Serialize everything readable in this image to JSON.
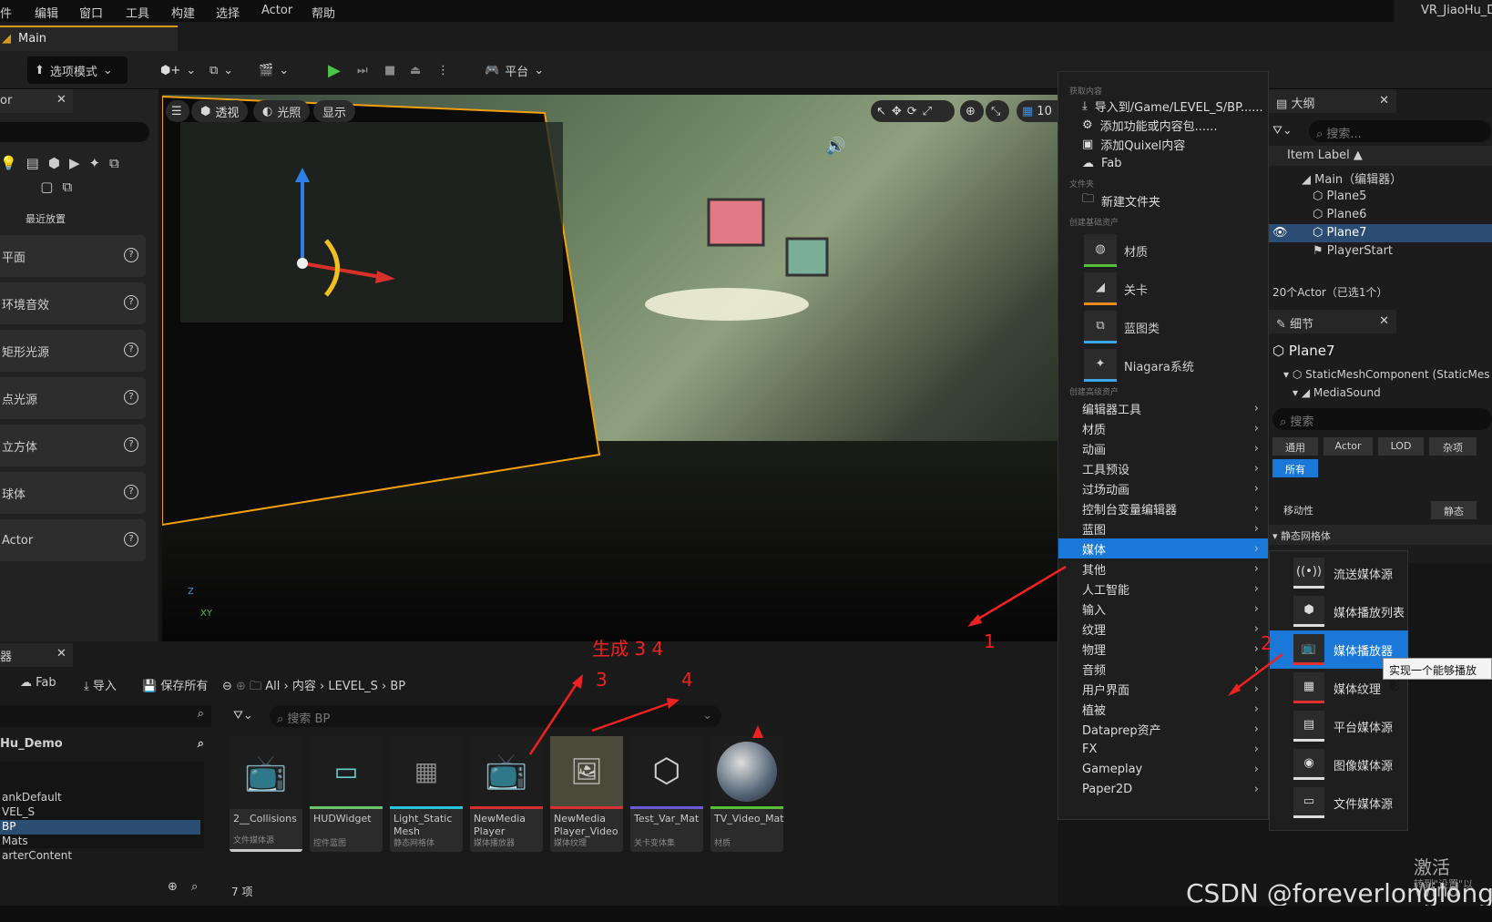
{
  "menubar": {
    "items": [
      "件",
      "编辑",
      "窗口",
      "工具",
      "构建",
      "选择",
      "Actor",
      "帮助"
    ],
    "project": "VR_JiaoHu_D"
  },
  "tabs": {
    "main": "Main"
  },
  "toolbar": {
    "mode": "选项模式",
    "platform": "平台"
  },
  "left_panel": {
    "title": "or",
    "recent": "最近放置",
    "items": [
      "平面",
      "环境音效",
      "矩形光源",
      "点光源",
      "立方体",
      "球体",
      "Actor"
    ]
  },
  "viewport": {
    "perspective": "透视",
    "lighting": "光照",
    "show": "显示",
    "grid": "10",
    "axis_z": "Z",
    "axis_xy": "XY"
  },
  "context_menu": {
    "section_get": "获取内容",
    "get_items": [
      "导入到/Game/LEVEL_S/BP......",
      "添加功能或内容包......",
      "添加Quixel内容",
      "Fab"
    ],
    "section_folder": "文件夹",
    "new_folder": "新建文件夹",
    "section_basic": "创建基础资产",
    "basic_assets": [
      "材质",
      "关卡",
      "蓝图类",
      "Niagara系统"
    ],
    "section_advanced": "创建高级资产",
    "advanced": [
      "编辑器工具",
      "材质",
      "动画",
      "工具预设",
      "过场动画",
      "控制台变量编辑器",
      "蓝图",
      "媒体",
      "其他",
      "人工智能",
      "输入",
      "纹理",
      "物理",
      "音频",
      "用户界面",
      "植被",
      "Dataprep资产",
      "FX",
      "Gameplay",
      "Paper2D"
    ]
  },
  "media_submenu": [
    "流送媒体源",
    "媒体播放列表",
    "媒体播放器",
    "媒体纹理",
    "平台媒体源",
    "图像媒体源",
    "文件媒体源"
  ],
  "tooltip": "实现一个能够播放影",
  "outliner": {
    "title": "大纲",
    "search": "搜索...",
    "column": "Item Label",
    "items": [
      "Main（编辑器）",
      "Plane5",
      "Plane6",
      "Plane7",
      "PlayerStart"
    ],
    "count": "20个Actor（已选1个）"
  },
  "details": {
    "title": "细节",
    "object": "Plane7",
    "component": "StaticMeshComponent (StaticMes",
    "sub": "MediaSound",
    "search": "搜索",
    "filters": [
      "通用",
      "Actor",
      "LOD",
      "杂项",
      "所有"
    ],
    "mobility_label": "移动性",
    "mobility_value": "静态",
    "section": "静态网格体"
  },
  "content_browser": {
    "title": "器",
    "fab": "Fab",
    "import": "导入",
    "save_all": "保存所有",
    "path": [
      "All",
      "内容",
      "LEVEL_S",
      "BP"
    ],
    "search": "搜索 BP",
    "project": "Hu_Demo",
    "folders": [
      "ankDefault",
      "VEL_S",
      "BP",
      "Mats",
      "arterContent"
    ],
    "count": "7 项",
    "items": [
      {
        "name": "2__Collisions",
        "type": "文件媒体源",
        "color": "#c9c9c9"
      },
      {
        "name": "HUDWidget",
        "type": "控件蓝图",
        "color": "#6cc36c"
      },
      {
        "name": "Light_Static Mesh",
        "type": "静态网格体",
        "color": "#27c6d6"
      },
      {
        "name": "NewMedia Player",
        "type": "媒体播放器",
        "color": "#d63030"
      },
      {
        "name": "NewMedia Player_Video",
        "type": "媒体纹理",
        "color": "#d63030"
      },
      {
        "name": "Test_Var_Mat",
        "type": "关卡变体集",
        "color": "#6b5bd6"
      },
      {
        "name": "TV_Video_Mat",
        "type": "材质",
        "color": "#58c038"
      }
    ]
  },
  "annotations": {
    "a1": "1",
    "a2": "2",
    "a3": "3",
    "a4": "4",
    "gen": "生成 3 4"
  },
  "watermark": {
    "csdn": "CSDN @foreverlonglong",
    "activate": "激活 Wind",
    "activate2": "转到\"设置\"以"
  }
}
